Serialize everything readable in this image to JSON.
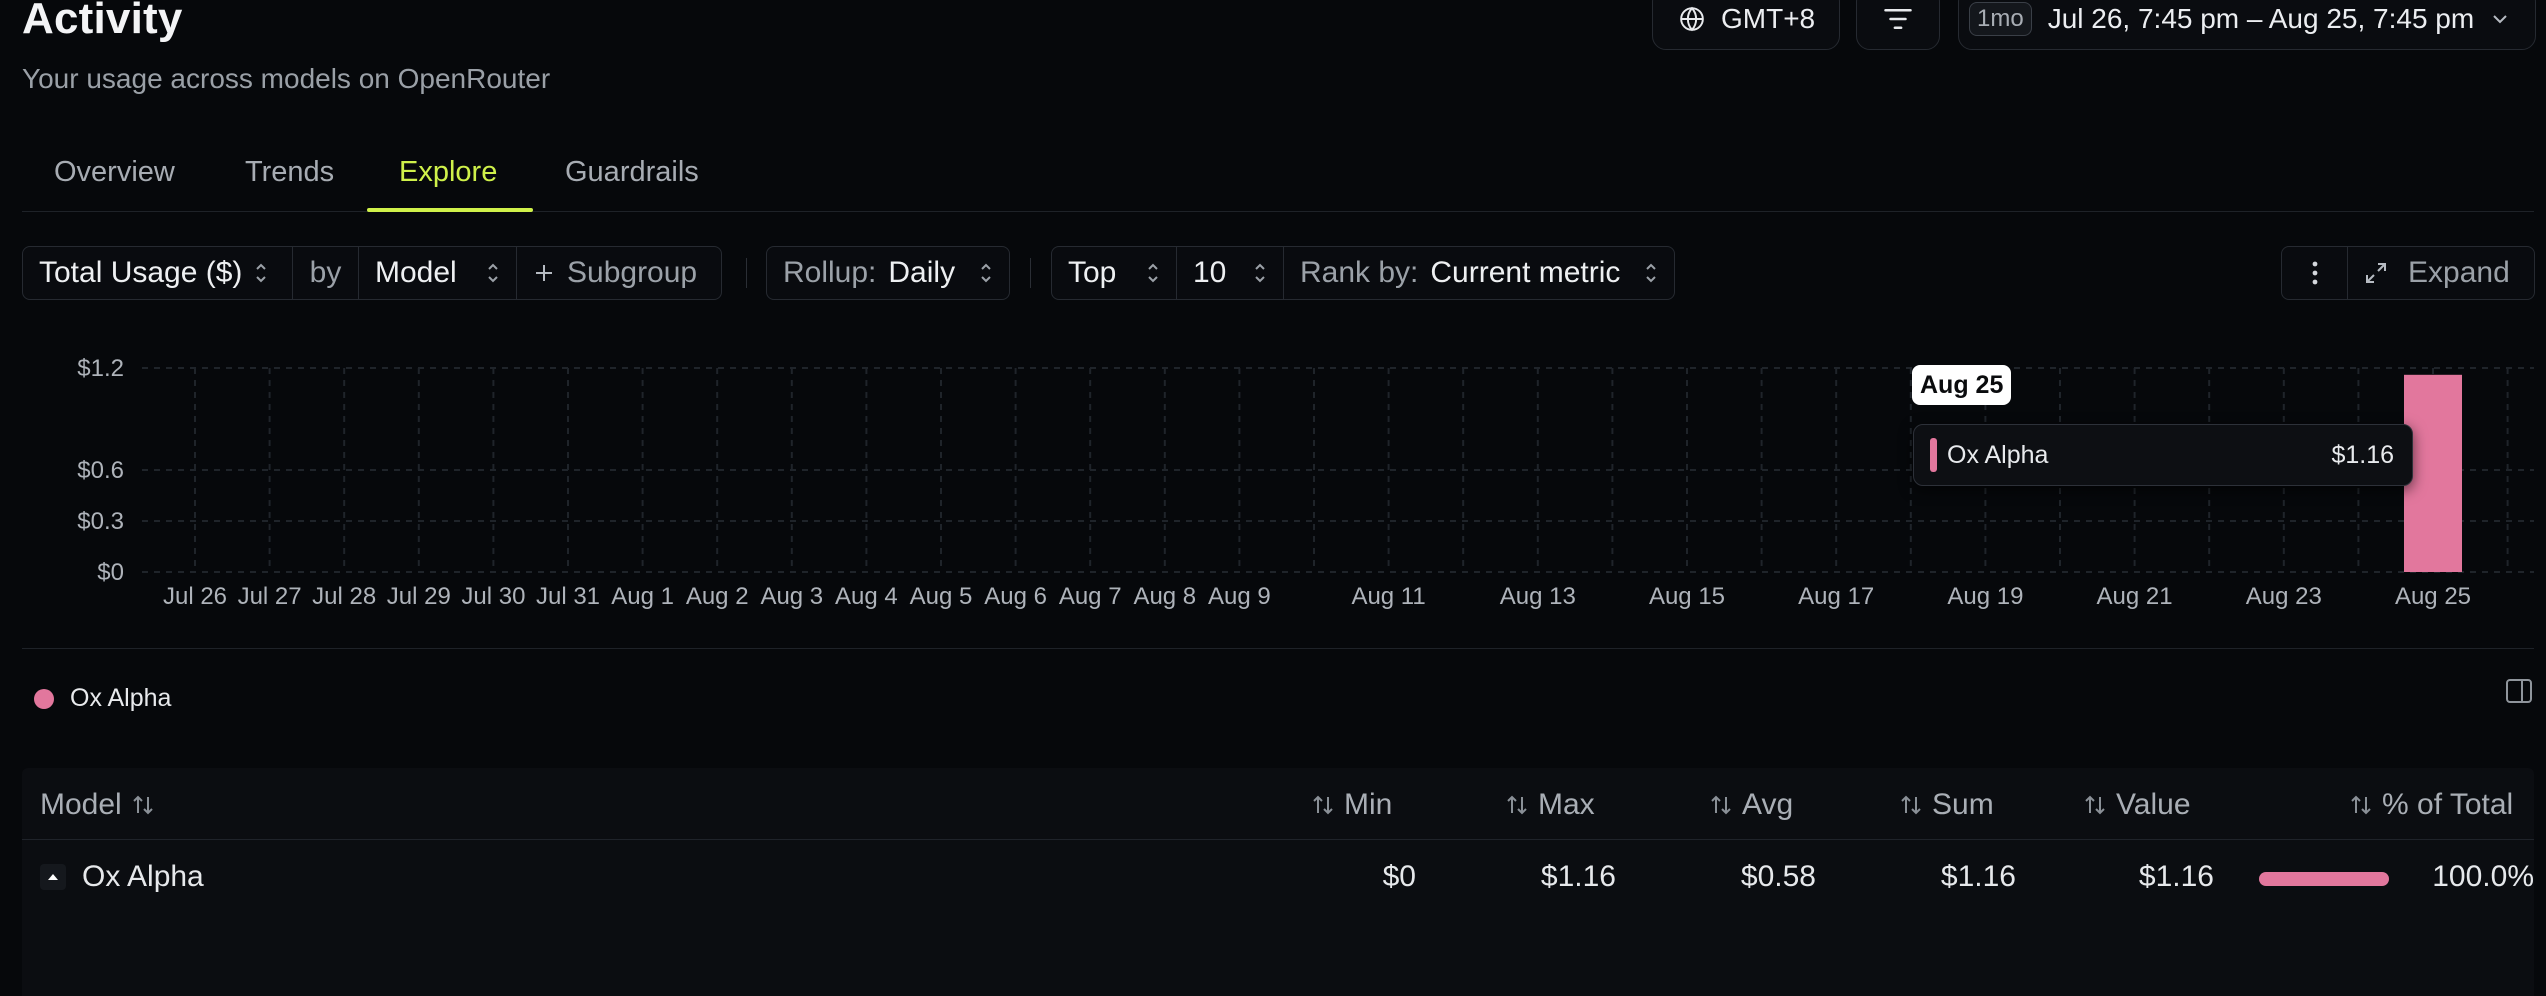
{
  "header": {
    "title": "Activity",
    "subtitle": "Your usage across models on OpenRouter",
    "timezone_label": "GMT+8",
    "range_badge": "1mo",
    "range_label": "Jul 26, 7:45 pm – Aug 25, 7:45 pm"
  },
  "tabs": [
    {
      "label": "Overview",
      "active": false
    },
    {
      "label": "Trends",
      "active": false
    },
    {
      "label": "Explore",
      "active": true
    },
    {
      "label": "Guardrails",
      "active": false
    }
  ],
  "toolbar": {
    "metric": "Total Usage ($)",
    "by_label": "by",
    "group": "Model",
    "subgroup_label": "Subgroup",
    "rollup_label": "Rollup:",
    "rollup_value": "Daily",
    "top_label": "Top",
    "top_value": "10",
    "rank_label": "Rank by:",
    "rank_value": "Current metric",
    "expand_label": "Expand"
  },
  "chart_data": {
    "type": "bar",
    "x_tick_labels": [
      "Jul 26",
      "Jul 27",
      "Jul 28",
      "Jul 29",
      "Jul 30",
      "Jul 31",
      "Aug 1",
      "Aug 2",
      "Aug 3",
      "Aug 4",
      "Aug 5",
      "Aug 6",
      "Aug 7",
      "Aug 8",
      "Aug 9",
      "Aug 11",
      "Aug 13",
      "Aug 15",
      "Aug 17",
      "Aug 19",
      "Aug 21",
      "Aug 23",
      "Aug 25"
    ],
    "y_tick_labels": [
      "$0",
      "$0.3",
      "$0.6",
      "$1.2"
    ],
    "y_ticks": [
      0,
      0.3,
      0.6,
      1.2
    ],
    "ylim": [
      0,
      1.2
    ],
    "series": [
      {
        "name": "Ox Alpha",
        "color": "#e2779d",
        "points": [
          {
            "x": "Aug 25",
            "y": 1.16
          }
        ]
      }
    ],
    "tooltip": {
      "date": "Aug 25",
      "series": "Ox Alpha",
      "value": "$1.16"
    },
    "grid": true
  },
  "legend": [
    {
      "label": "Ox Alpha",
      "color": "#e2779d"
    }
  ],
  "table": {
    "columns": [
      "Model",
      "Min",
      "Max",
      "Avg",
      "Sum",
      "Value",
      "% of Total"
    ],
    "rows": [
      {
        "model": "Ox Alpha",
        "min": "$0",
        "max": "$1.16",
        "avg": "$0.58",
        "sum": "$1.16",
        "value": "$1.16",
        "pct": "100.0%",
        "pct_fraction": 1.0
      }
    ]
  },
  "colors": {
    "accent": "#cff14a",
    "series": "#e2779d",
    "background": "#06080b"
  }
}
